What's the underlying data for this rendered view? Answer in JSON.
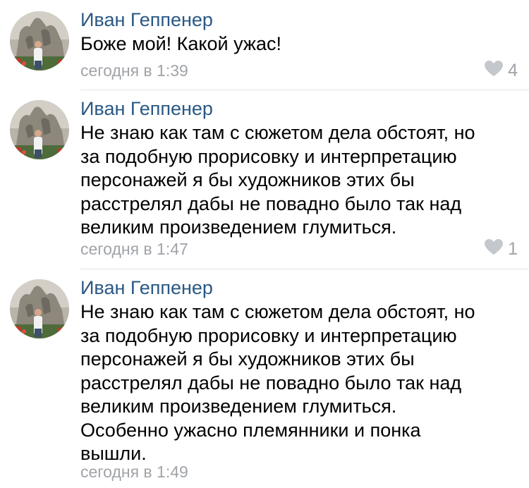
{
  "comments": [
    {
      "author": "Иван Геппенер",
      "text": "Боже мой! Какой ужас!",
      "time": "сегодня в 1:39",
      "likes": "4",
      "like_icon": "heart-icon"
    },
    {
      "author": "Иван Геппенер",
      "text": "Не знаю как там с сюжетом дела обстоят, но\nза подобную прорисовку и интерпретацию\nперсонажей я бы художников этих бы\nрасстрелял дабы не повадно было так над\nвеликим произведением глумиться.",
      "time": "сегодня в 1:47",
      "likes": "1",
      "like_icon": "heart-icon"
    },
    {
      "author": "Иван Геппенер",
      "text": "Не знаю как там с сюжетом дела обстоят, но\nза подобную прорисовку и интерпретацию\nперсонажей я бы художников этих бы\nрасстрелял дабы не повадно было так над\nвеликим произведением глумиться.\nОсобенно ужасно племянники и понка\nвышли.",
      "time": "сегодня в 1:49"
    }
  ],
  "colors": {
    "author": "#2a5885",
    "meta": "#a0a3a8",
    "divider": "#e3e4e8"
  }
}
